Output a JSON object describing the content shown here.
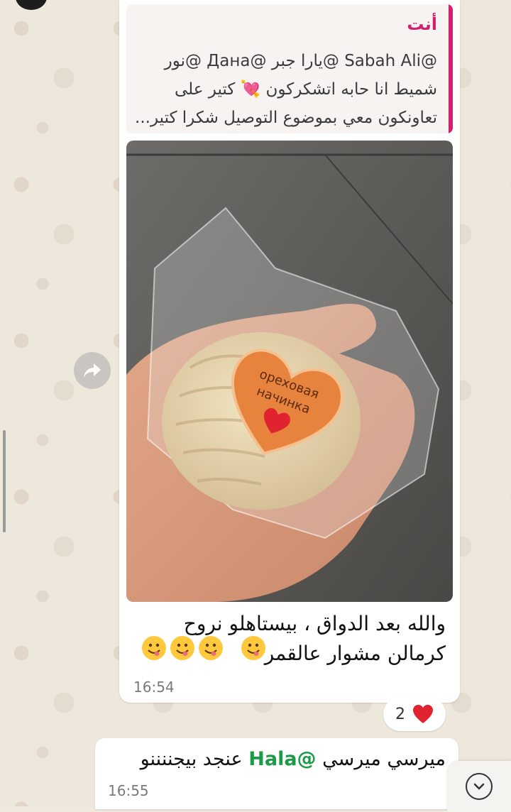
{
  "colors": {
    "accent_quote": "#d21f6e",
    "mention_green": "#1a9c47",
    "bubble_bg": "#ffffff",
    "wallpaper": "#eee7dc",
    "heart": "#e0242f"
  },
  "message_main": {
    "quote": {
      "sender": "أنت",
      "line1": "@Sabah Ali @يارا جبر @Дана @نور",
      "line2": "شميط انا حابه اتشكركون 💘 كتير على",
      "line3": "تعاونكون معي بموضوع التوصيل شكرا كتير..."
    },
    "photo": {
      "sticker_text_line1": "ореховая",
      "sticker_text_line2": "начинка"
    },
    "caption_line1": "والله بعد الدواق ، بيستاهلو نروح",
    "caption_line2": "كرمالن مشوار عالقمر",
    "emoji_count": 4,
    "time": "16:54"
  },
  "reaction": {
    "emoji_icon": "heart-icon",
    "count": "2"
  },
  "message_second": {
    "text_before": "ميرسي ميرسي",
    "mention": "@Hala",
    "text_after": "عنجد بيجننننو",
    "time": "16:55"
  },
  "icons": {
    "forward": "forward-arrow-icon",
    "scroll_down": "chevron-down-icon"
  }
}
